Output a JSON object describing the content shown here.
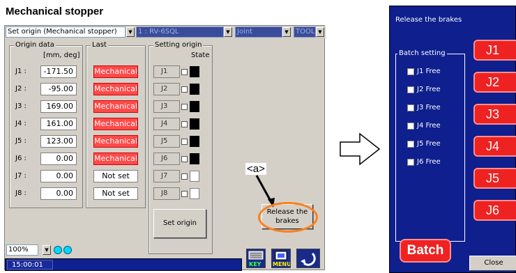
{
  "heading": "Mechanical stopper",
  "topbar": {
    "mode": "Set origin (Mechanical stopper)",
    "robot": "1 : RV-6SQL",
    "frame": "Joint",
    "tool": "TOOL0"
  },
  "origin_data": {
    "label": "Origin data",
    "units": "[mm, deg]",
    "rows": [
      {
        "joint": "J1 :",
        "value": "-171.50"
      },
      {
        "joint": "J2 :",
        "value": "-95.00"
      },
      {
        "joint": "J3 :",
        "value": "169.00"
      },
      {
        "joint": "J4 :",
        "value": "161.00"
      },
      {
        "joint": "J5 :",
        "value": "123.00"
      },
      {
        "joint": "J6 :",
        "value": "0.00"
      },
      {
        "joint": "J7 :",
        "value": "0.00"
      },
      {
        "joint": "J8 :",
        "value": "0.00"
      }
    ]
  },
  "last": {
    "label": "Last",
    "rows": [
      "Mechanical",
      "Mechanical",
      "Mechanical",
      "Mechanical",
      "Mechanical",
      "Mechanical",
      "Not set",
      "Not set"
    ]
  },
  "setting_origin": {
    "label": "Setting origin",
    "state_label": "State",
    "rows": [
      {
        "joint": "J1",
        "state": "black"
      },
      {
        "joint": "J2",
        "state": "black"
      },
      {
        "joint": "J3",
        "state": "black"
      },
      {
        "joint": "J4",
        "state": "black"
      },
      {
        "joint": "J5",
        "state": "black"
      },
      {
        "joint": "J6",
        "state": "black"
      },
      {
        "joint": "J7",
        "state": "white"
      },
      {
        "joint": "J8",
        "state": "white"
      }
    ],
    "button": "Set origin"
  },
  "release_button": {
    "line1": "Release the",
    "line2": "brakes"
  },
  "annotation": "<a>",
  "zoom": "100%",
  "status": {
    "time": "15:00:01"
  },
  "icons": {
    "key": "KEY",
    "menu": "MENU"
  },
  "right": {
    "title": "Release the brakes",
    "batch_label": "Batch setting",
    "free": [
      "J1 Free",
      "J2 Free",
      "J3 Free",
      "J4 Free",
      "J5 Free",
      "J6 Free"
    ],
    "joints": [
      "J1",
      "J2",
      "J3",
      "J4",
      "J5",
      "J6"
    ],
    "batch_button": "Batch",
    "close_button": "Close"
  }
}
